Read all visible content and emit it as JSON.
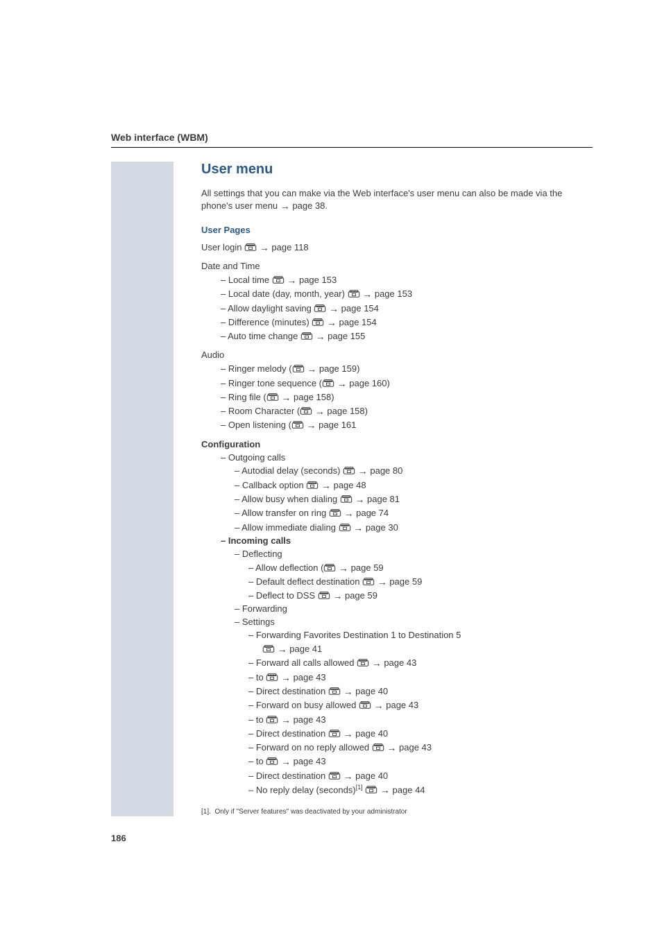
{
  "header": {
    "title": "Web interface (WBM)"
  },
  "page_number": "186",
  "usermenu": {
    "title": "User menu",
    "intro_a": "All settings that you can make via the Web interface's user menu can also be made via the phone's user menu ",
    "intro_page": "page 38",
    "intro_b": ".",
    "user_pages_label": "User Pages",
    "user_login": {
      "text": "User login ",
      "page": "page 118"
    },
    "date_time": {
      "label": "Date and Time",
      "items": [
        {
          "text": "Local time ",
          "page": "page 153"
        },
        {
          "text": "Local date (day, month, year) ",
          "page": "page 153"
        },
        {
          "text": "Allow daylight saving ",
          "page": "page 154"
        },
        {
          "text": "Difference (minutes) ",
          "page": "page 154"
        },
        {
          "text": "Auto time change ",
          "page": "page 155"
        }
      ]
    },
    "audio": {
      "label": "Audio",
      "items": [
        {
          "text": "Ringer melody (",
          "page": "page 159",
          "close": ")"
        },
        {
          "text": "Ringer tone sequence (",
          "page": "page 160",
          "close": ")"
        },
        {
          "text": "Ring file (",
          "page": "page 158",
          "close": ")"
        },
        {
          "text": "Room Character (",
          "page": "page 158",
          "close": ")"
        },
        {
          "text": "Open listening (",
          "page": "page 161",
          "close": ""
        }
      ]
    },
    "configuration": {
      "label": "Configuration",
      "outgoing": {
        "label": "Outgoing calls",
        "items": [
          {
            "text": "Autodial delay (seconds)  ",
            "page": "page 80"
          },
          {
            "text": "Callback option ",
            "page": "page 48"
          },
          {
            "text": "Allow busy when dialing ",
            "page": "page 81"
          },
          {
            "text": "Allow transfer on ring ",
            "page": "page 74"
          },
          {
            "text": "Allow immediate dialing ",
            "page": "page 30"
          }
        ]
      },
      "incoming": {
        "label": "Incoming calls",
        "deflecting": {
          "label": "Deflecting",
          "items": [
            {
              "text": "Allow deflection (",
              "page": "page 59"
            },
            {
              "text": "Default deflect destination ",
              "page": "page 59"
            },
            {
              "text": "Deflect to DSS ",
              "page": "page 59"
            }
          ]
        },
        "forwarding_label": "Forwarding",
        "settings_label": "Settings",
        "settings": {
          "line1_a": "Forwarding Favorites Destination 1 to Destination 5",
          "line1_page": "page 41",
          "items": [
            {
              "text": "Forward all calls allowed ",
              "page": "page 43"
            },
            {
              "text": "to  ",
              "page": "page 43"
            },
            {
              "text": "Direct destination ",
              "page": "page 40"
            },
            {
              "text": "Forward on busy allowed ",
              "page": "page 43"
            },
            {
              "text": "to ",
              "page": "page 43"
            },
            {
              "text": "Direct destination ",
              "page": "page 40"
            },
            {
              "text": "Forward on no reply allowed ",
              "page": "page 43"
            },
            {
              "text": "to ",
              "page": "page 43"
            },
            {
              "text": "Direct destination ",
              "page": "page 40"
            },
            {
              "text": "No reply delay (seconds)",
              "sup": "[1]",
              "page": "page 44"
            }
          ]
        }
      }
    }
  },
  "footnote": {
    "marker": "[1].",
    "text": "Only if \"Server features\" was deactivated by your administrator"
  }
}
